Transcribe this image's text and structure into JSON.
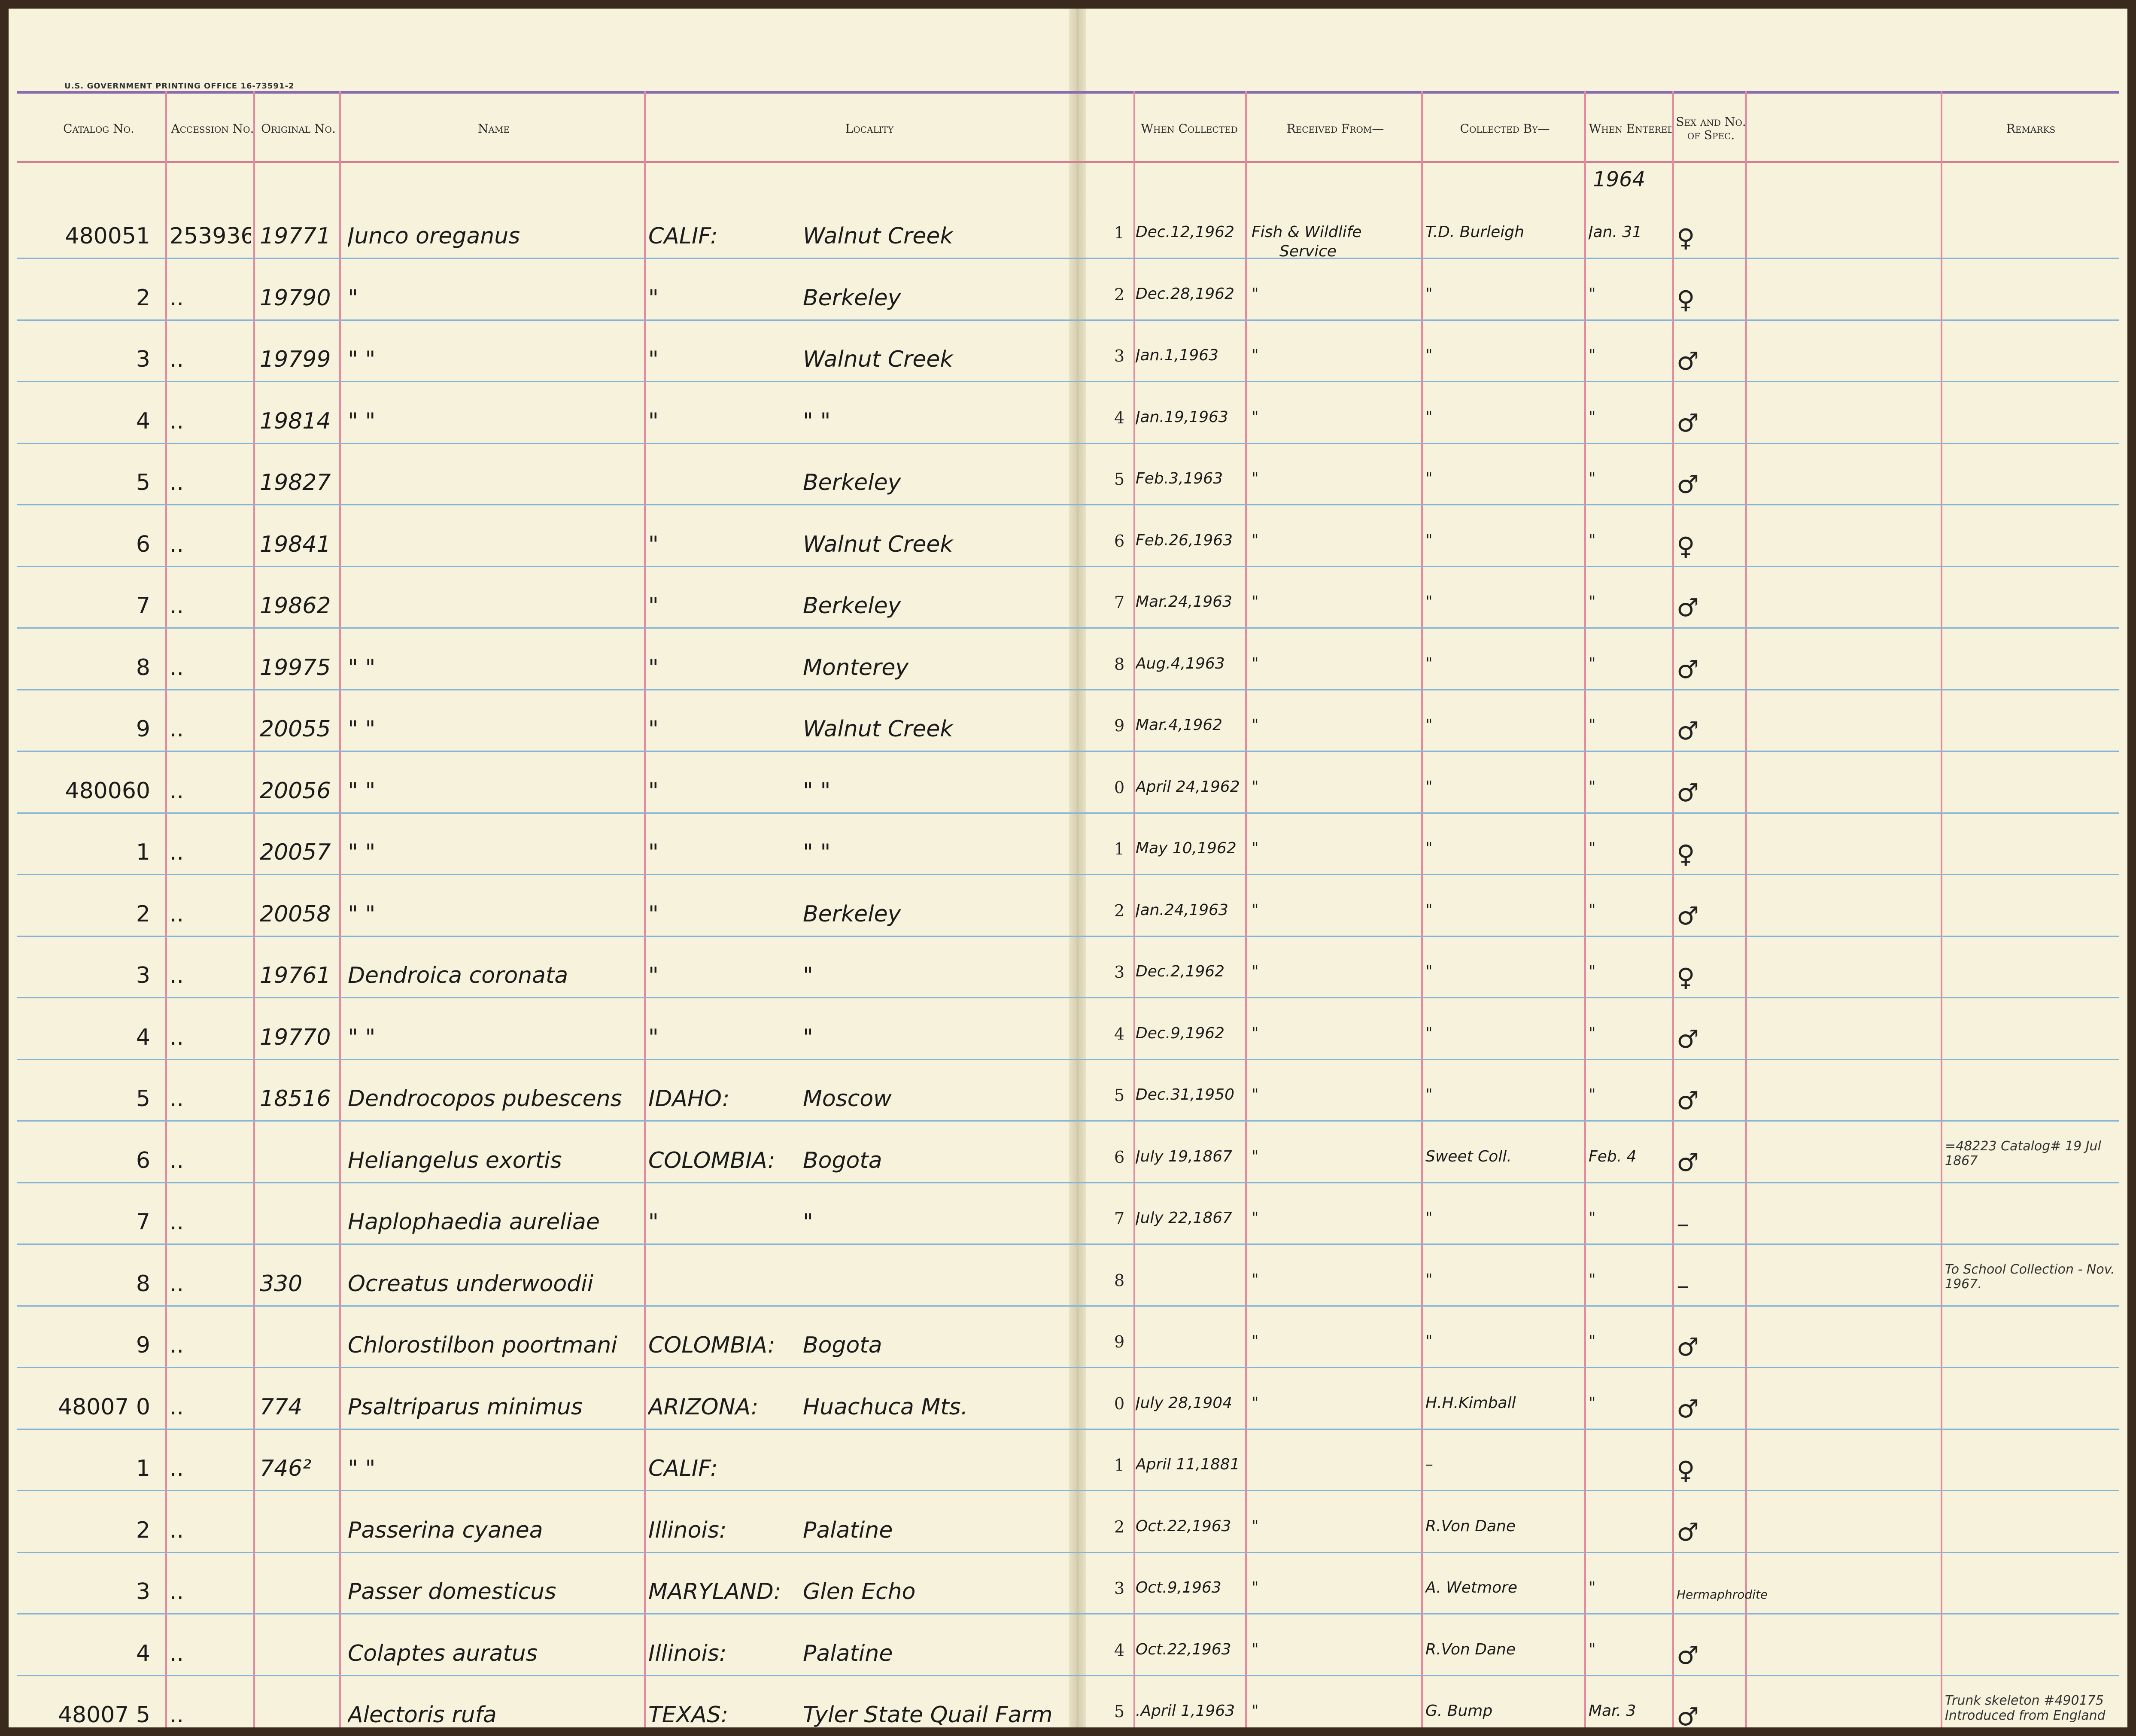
{
  "printer_line": "U.S. GOVERNMENT PRINTING OFFICE   16-73591-2",
  "headers": {
    "catalog_no": "Catalog No.",
    "accession_no": "Accession No.",
    "original_no": "Original No.",
    "name": "Name",
    "locality": "Locality",
    "when_collected": "When Collected",
    "received_from": "Received From—",
    "collected_by": "Collected By—",
    "when_entered": "When Entered",
    "sex_no_spec": "Sex and No. of Spec.",
    "remarks": "Remarks"
  },
  "year_entered": "1964",
  "rows": [
    {
      "catalog": "480051",
      "accession": "253936",
      "original": "19771",
      "name": "Junco oreganus",
      "locality_region": "CALIF:",
      "locality_place": "Walnut Creek",
      "row_digit": "1",
      "collected": "Dec.12,1962",
      "received": "Fish & Wildlife",
      "received2": "Service",
      "collector": "T.D. Burleigh",
      "entered": "Jan. 31",
      "sex": "♀",
      "remarks": ""
    },
    {
      "catalog": "2",
      "accession": "..",
      "original": "19790",
      "name": "\"",
      "locality_region": "\"",
      "locality_place": "Berkeley",
      "row_digit": "2",
      "collected": "Dec.28,1962",
      "received": "\"",
      "received2": "",
      "collector": "\"",
      "entered": "\"",
      "sex": "♀",
      "remarks": ""
    },
    {
      "catalog": "3",
      "accession": "..",
      "original": "19799",
      "name": "\"     \"",
      "locality_region": "\"",
      "locality_place": "Walnut Creek",
      "row_digit": "3",
      "collected": "Jan.1,1963",
      "received": "\"",
      "received2": "",
      "collector": "\"",
      "entered": "\"",
      "sex": "♂",
      "remarks": ""
    },
    {
      "catalog": "4",
      "accession": "..",
      "original": "19814",
      "name": "\"     \"",
      "locality_region": "\"",
      "locality_place": "\"     \"",
      "row_digit": "4",
      "collected": "Jan.19,1963",
      "received": "\"",
      "received2": "",
      "collector": "\"",
      "entered": "\"",
      "sex": "♂",
      "remarks": ""
    },
    {
      "catalog": "5",
      "accession": "..",
      "original": "19827",
      "name": "",
      "locality_region": "",
      "locality_place": "Berkeley",
      "row_digit": "5",
      "collected": "Feb.3,1963",
      "received": "\"",
      "received2": "",
      "collector": "\"",
      "entered": "\"",
      "sex": "♂",
      "remarks": ""
    },
    {
      "catalog": "6",
      "accession": "..",
      "original": "19841",
      "name": "",
      "locality_region": "\"",
      "locality_place": "Walnut Creek",
      "row_digit": "6",
      "collected": "Feb.26,1963",
      "received": "\"",
      "received2": "",
      "collector": "\"",
      "entered": "\"",
      "sex": "♀",
      "remarks": ""
    },
    {
      "catalog": "7",
      "accession": "..",
      "original": "19862",
      "name": "",
      "locality_region": "\"",
      "locality_place": "Berkeley",
      "row_digit": "7",
      "collected": "Mar.24,1963",
      "received": "\"",
      "received2": "",
      "collector": "\"",
      "entered": "\"",
      "sex": "♂",
      "remarks": ""
    },
    {
      "catalog": "8",
      "accession": "..",
      "original": "19975",
      "name": "\"     \"",
      "locality_region": "\"",
      "locality_place": "Monterey",
      "row_digit": "8",
      "collected": "Aug.4,1963",
      "received": "\"",
      "received2": "",
      "collector": "\"",
      "entered": "\"",
      "sex": "♂",
      "remarks": ""
    },
    {
      "catalog": "9",
      "accession": "..",
      "original": "20055",
      "name": "\"     \"",
      "locality_region": "\"",
      "locality_place": "Walnut Creek",
      "row_digit": "9",
      "collected": "Mar.4,1962",
      "received": "\"",
      "received2": "",
      "collector": "\"",
      "entered": "\"",
      "sex": "♂",
      "remarks": ""
    },
    {
      "catalog": "480060",
      "accession": "..",
      "original": "20056",
      "name": "\"     \"",
      "locality_region": "\"",
      "locality_place": "\"     \"",
      "row_digit": "0",
      "collected": "April 24,1962",
      "received": "\"",
      "received2": "",
      "collector": "\"",
      "entered": "\"",
      "sex": "♂",
      "remarks": ""
    },
    {
      "catalog": "1",
      "accession": "..",
      "original": "20057",
      "name": "\"     \"",
      "locality_region": "\"",
      "locality_place": "\"     \"",
      "row_digit": "1",
      "collected": "May 10,1962",
      "received": "\"",
      "received2": "",
      "collector": "\"",
      "entered": "\"",
      "sex": "♀",
      "remarks": ""
    },
    {
      "catalog": "2",
      "accession": "..",
      "original": "20058",
      "name": "\"     \"",
      "locality_region": "\"",
      "locality_place": "Berkeley",
      "row_digit": "2",
      "collected": "Jan.24,1963",
      "received": "\"",
      "received2": "",
      "collector": "\"",
      "entered": "\"",
      "sex": "♂",
      "remarks": ""
    },
    {
      "catalog": "3",
      "accession": "..",
      "original": "19761",
      "name": "Dendroica coronata",
      "locality_region": "\"",
      "locality_place": "\"",
      "row_digit": "3",
      "collected": "Dec.2,1962",
      "received": "\"",
      "received2": "",
      "collector": "\"",
      "entered": "\"",
      "sex": "♀",
      "remarks": ""
    },
    {
      "catalog": "4",
      "accession": "..",
      "original": "19770",
      "name": "\"     \"",
      "locality_region": "\"",
      "locality_place": "\"",
      "row_digit": "4",
      "collected": "Dec.9,1962",
      "received": "\"",
      "received2": "",
      "collector": "\"",
      "entered": "\"",
      "sex": "♂",
      "remarks": ""
    },
    {
      "catalog": "5",
      "accession": "..",
      "original": "18516",
      "name": "Dendrocopos pubescens",
      "locality_region": "IDAHO:",
      "locality_place": "Moscow",
      "row_digit": "5",
      "collected": "Dec.31,1950",
      "received": "\"",
      "received2": "",
      "collector": "\"",
      "entered": "\"",
      "sex": "♂",
      "remarks": ""
    },
    {
      "catalog": "6",
      "accession": "..",
      "original": "",
      "name": "Heliangelus exortis",
      "locality_region": "COLOMBIA:",
      "locality_place": "Bogota",
      "row_digit": "6",
      "collected": "July 19,1867",
      "received": "\"",
      "received2": "",
      "collector": "Sweet Coll.",
      "entered": "Feb. 4",
      "sex": "♂",
      "remarks": "=48223 Catalog# 19 Jul 1867"
    },
    {
      "catalog": "7",
      "accession": "..",
      "original": "",
      "name": "Haplophaedia aureliae",
      "locality_region": "\"",
      "locality_place": "\"",
      "row_digit": "7",
      "collected": "July 22,1867",
      "received": "\"",
      "received2": "",
      "collector": "\"",
      "entered": "\"",
      "sex": "–",
      "remarks": ""
    },
    {
      "catalog": "8",
      "accession": "..",
      "original": "330",
      "name": "Ocreatus underwoodii",
      "locality_region": "",
      "locality_place": "",
      "row_digit": "8",
      "collected": "",
      "received": "\"",
      "received2": "",
      "collector": "\"",
      "entered": "\"",
      "sex": "–",
      "remarks": "To School Collection - Nov. 1967."
    },
    {
      "catalog": "9",
      "accession": "..",
      "original": "",
      "name": "Chlorostilbon poortmani",
      "locality_region": "COLOMBIA:",
      "locality_place": "Bogota",
      "row_digit": "9",
      "collected": "",
      "received": "\"",
      "received2": "",
      "collector": "\"",
      "entered": "\"",
      "sex": "♂",
      "remarks": ""
    },
    {
      "catalog": "48007 0",
      "accession": "..",
      "original": "774",
      "name": "Psaltriparus minimus",
      "locality_region": "ARIZONA:",
      "locality_place": "Huachuca Mts.",
      "row_digit": "0",
      "collected": "July 28,1904",
      "received": "\"",
      "received2": "",
      "collector": "H.H.Kimball",
      "entered": "\"",
      "sex": "♂",
      "remarks": ""
    },
    {
      "catalog": "1",
      "accession": "..",
      "original": "746²",
      "name": "\"     \"",
      "locality_region": "CALIF:",
      "locality_place": "",
      "row_digit": "1",
      "collected": "April 11,1881",
      "received": "",
      "received2": "",
      "collector": "–",
      "entered": "",
      "sex": "♀",
      "remarks": ""
    },
    {
      "catalog": "2",
      "accession": "..",
      "original": "",
      "name": "Passerina cyanea",
      "locality_region": "Illinois:",
      "locality_place": "Palatine",
      "row_digit": "2",
      "collected": "Oct.22,1963",
      "received": "\"",
      "received2": "",
      "collector": "R.Von Dane",
      "entered": "",
      "sex": "♂",
      "remarks": ""
    },
    {
      "catalog": "3",
      "accession": "..",
      "original": "",
      "name": "Passer domesticus",
      "locality_region": "MARYLAND:",
      "locality_place": "Glen Echo",
      "row_digit": "3",
      "collected": "Oct.9,1963",
      "received": "\"",
      "received2": "",
      "collector": "A. Wetmore",
      "entered": "\"",
      "sex": "Hermaphrodite",
      "remarks": ""
    },
    {
      "catalog": "4",
      "accession": "..",
      "original": "",
      "name": "Colaptes auratus",
      "locality_region": "Illinois:",
      "locality_place": "Palatine",
      "row_digit": "4",
      "collected": "Oct.22,1963",
      "received": "\"",
      "received2": "",
      "collector": "R.Von Dane",
      "entered": "\"",
      "sex": "♂",
      "remarks": ""
    },
    {
      "catalog": "48007 5",
      "accession": "..",
      "original": "",
      "name": "Alectoris rufa",
      "locality_region": "TEXAS:",
      "locality_place": "Tyler State Quail Farm",
      "row_digit": "5",
      "collected": ".April 1,1963",
      "received": "\"",
      "received2": "",
      "collector": "G. Bump",
      "entered": "Mar. 3",
      "sex": "♂",
      "remarks": "Trunk skeleton #490175 Introduced from England"
    }
  ]
}
